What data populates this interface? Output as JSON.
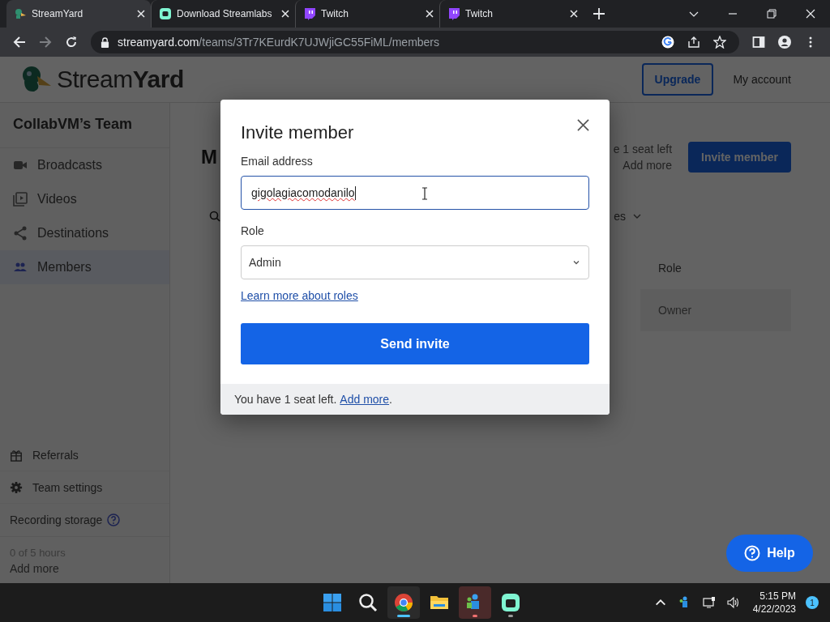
{
  "browser": {
    "tabs": [
      {
        "kind": "streamyard",
        "title": "StreamYard",
        "selected": true
      },
      {
        "kind": "streamlabs",
        "title": "Download Streamlabs",
        "selected": false
      },
      {
        "kind": "twitch",
        "title": "Twitch",
        "selected": false
      },
      {
        "kind": "twitch",
        "title": "Twitch",
        "selected": false
      }
    ],
    "address": {
      "host": "streamyard.com",
      "path": "/teams/3Tr7KEurdK7UJWjiGC55FiML/members"
    }
  },
  "header": {
    "logo": "Stream**Yard**",
    "upgrade": "Upgrade",
    "account": "My account"
  },
  "sidebar": {
    "team": "CollabVM’s Team",
    "items": [
      {
        "kind": "broadcasts",
        "label": "Broadcasts",
        "selected": false
      },
      {
        "kind": "videos",
        "label": "Videos",
        "selected": false
      },
      {
        "kind": "destinations",
        "label": "Destinations",
        "selected": false
      },
      {
        "kind": "members",
        "label": "Members",
        "selected": true
      }
    ],
    "bottom_items": [
      {
        "kind": "referrals",
        "label": "Referrals"
      },
      {
        "kind": "settings",
        "label": "Team settings"
      }
    ],
    "storage": {
      "label": "Recording storage",
      "usage": "0 of 5 hours",
      "add_more": "Add more"
    }
  },
  "main": {
    "heading": "M",
    "seats": "e 1 seat left",
    "add_more": "Add more",
    "invite_button": "Invite member",
    "filter": "es",
    "role_column": "Role",
    "rows": [
      {
        "role": "Owner"
      }
    ]
  },
  "dialog": {
    "title": "Invite member",
    "email_label": "Email address",
    "email_value": "gigolagiacomodanilo",
    "role_label": "Role",
    "role_value": "Admin",
    "learn_link": "Learn more about roles",
    "send_button": "Send invite",
    "footer_text": "You have 1 seat left.",
    "footer_link": "Add more",
    "footer_end": "."
  },
  "help": "Help",
  "taskbar": {
    "apps": [
      {
        "kind": "start",
        "selected": false,
        "running": false,
        "attention": false
      },
      {
        "kind": "search",
        "selected": false,
        "running": false,
        "attention": false
      },
      {
        "kind": "chrome",
        "selected": true,
        "running": true,
        "attention": false
      },
      {
        "kind": "files",
        "selected": false,
        "running": false,
        "attention": false
      },
      {
        "kind": "people",
        "selected": false,
        "running": true,
        "attention": true
      },
      {
        "kind": "streamlabs",
        "selected": false,
        "running": true,
        "attention": false
      }
    ],
    "time": "5:15 PM",
    "date": "4/22/2023",
    "notifications": "1"
  }
}
